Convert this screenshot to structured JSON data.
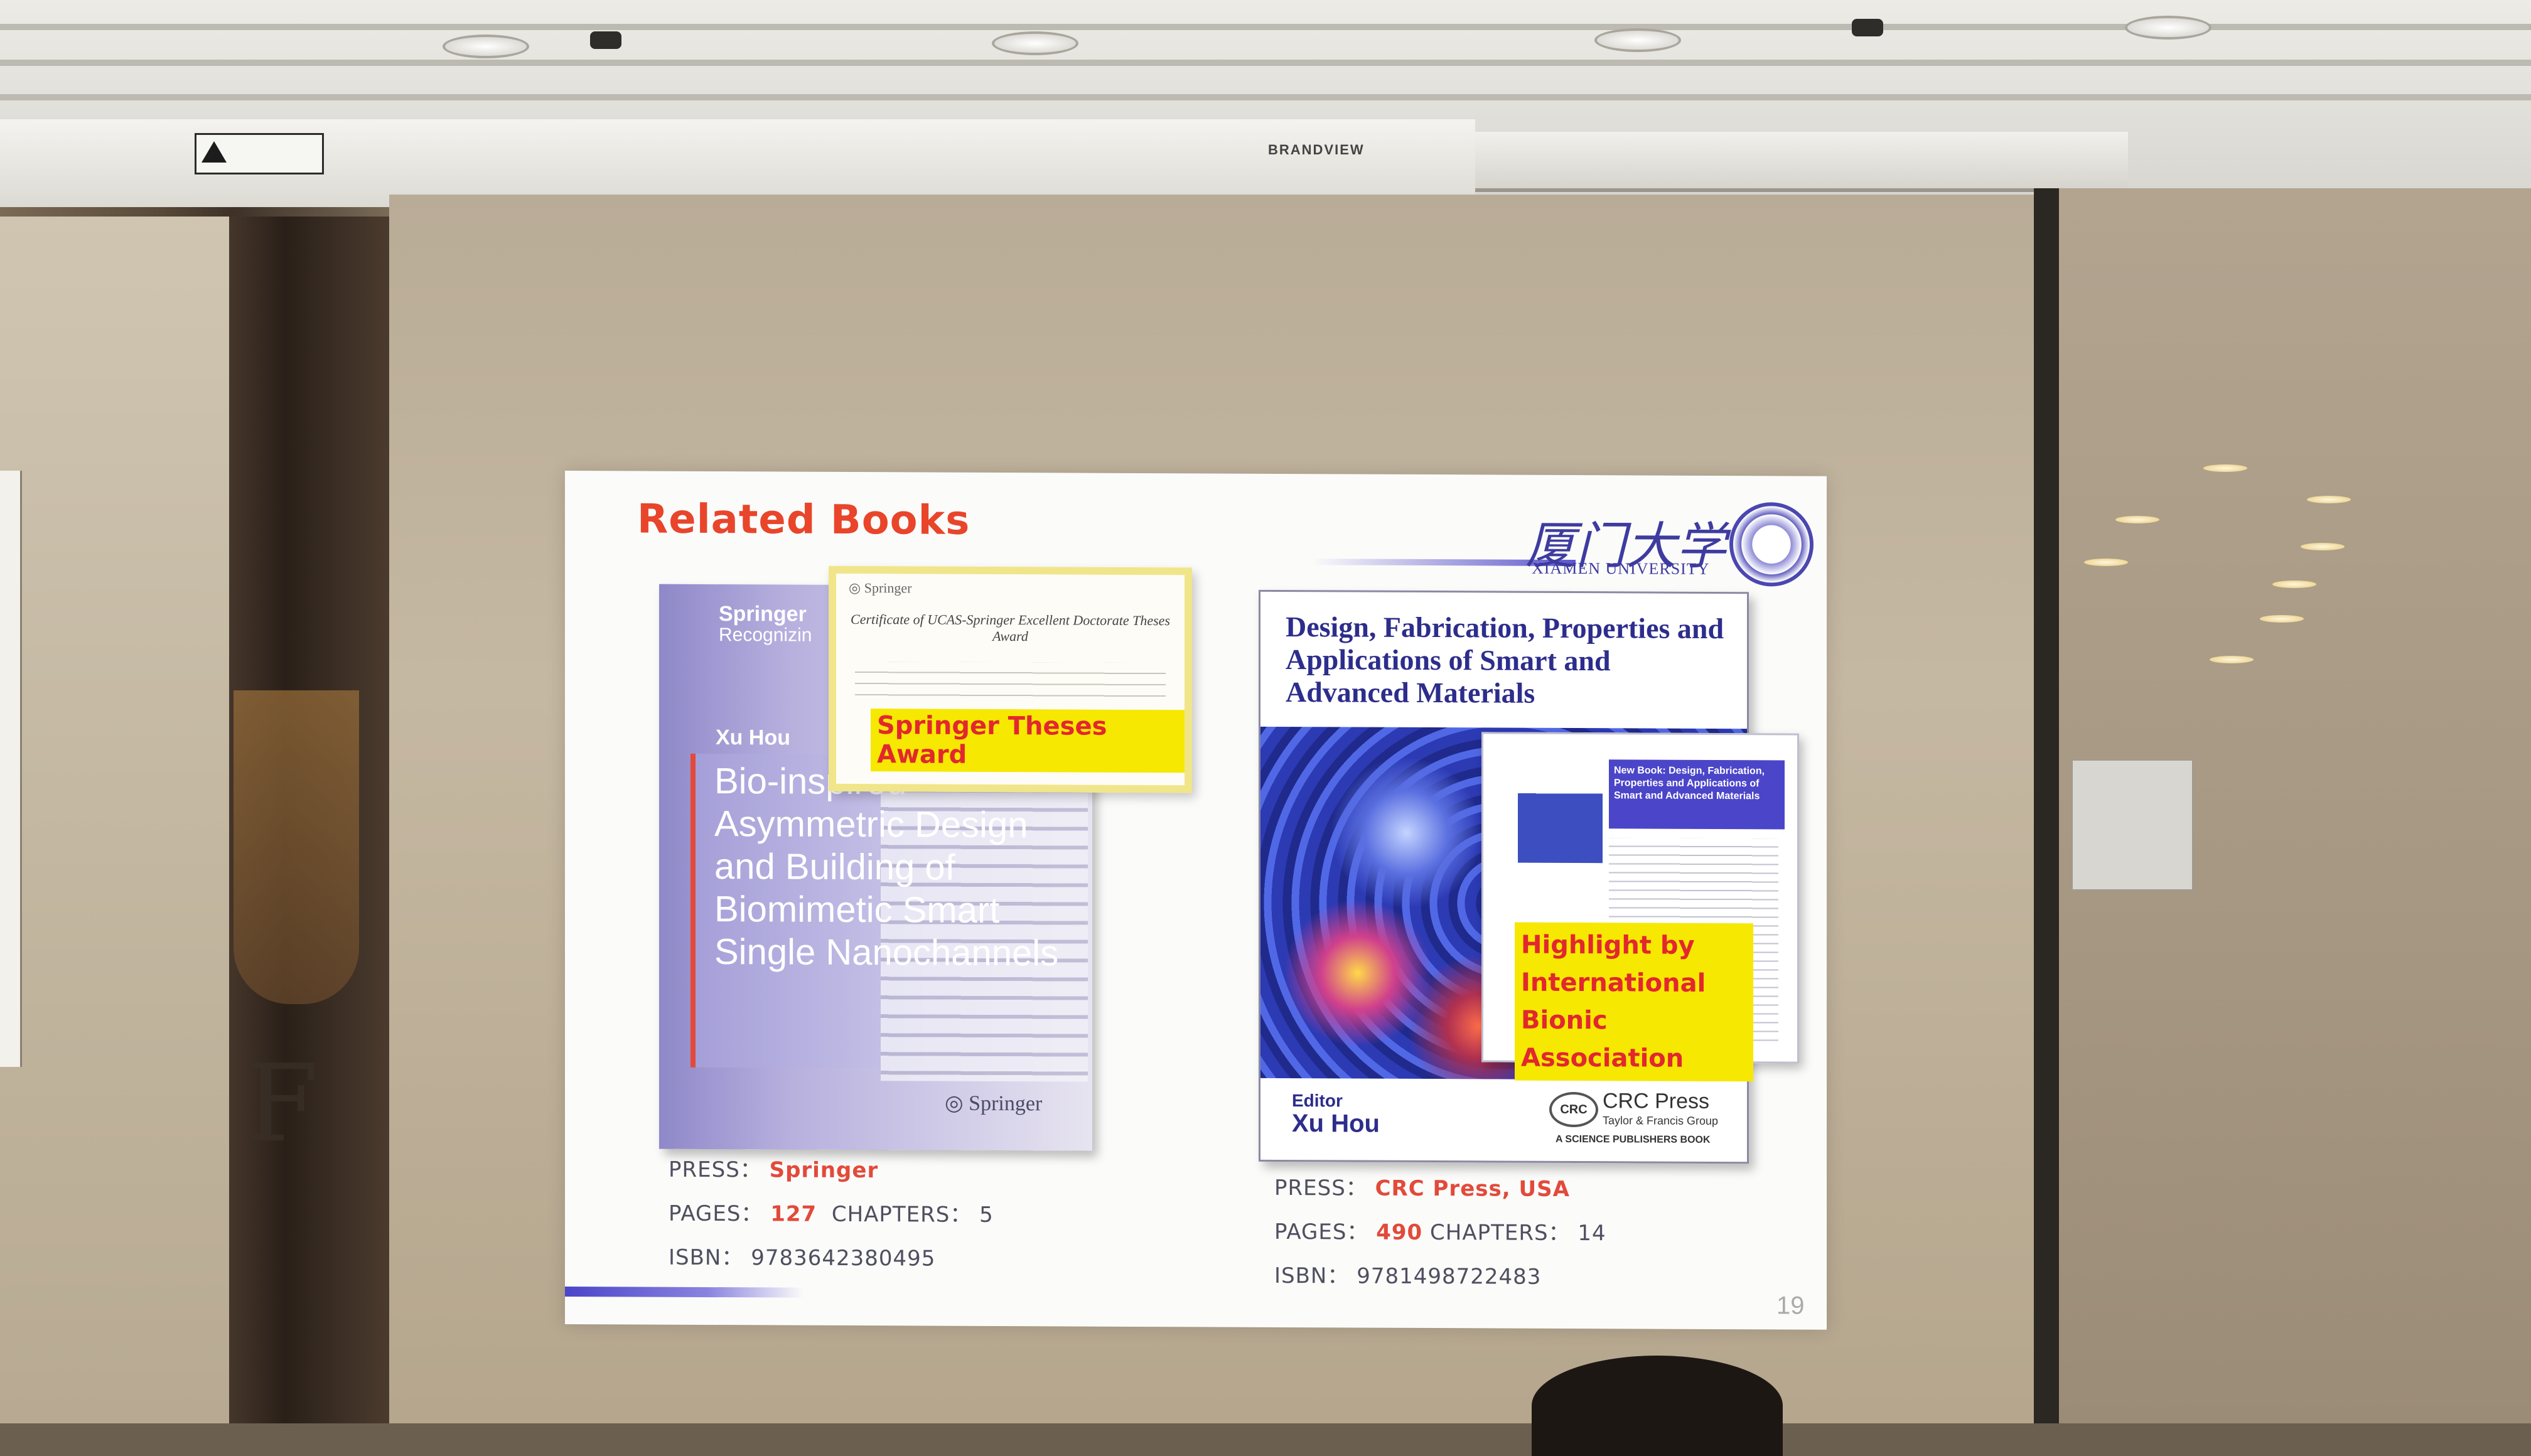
{
  "room": {
    "brand_label": "BRANDVIEW",
    "engraved_text": "F E"
  },
  "slide": {
    "title": "Related Books",
    "logo_cn": "厦门大学",
    "logo_en": "XIAMEN UNIVERSITY",
    "page_number": "19"
  },
  "book1": {
    "series": "Springer",
    "series_sub": "Recognizin",
    "author": "Xu Hou",
    "title": "Bio-inspired Asymmetric Design and Building of Biomimetic Smart Single Nanochannels",
    "publisher_mark": "Springer",
    "certificate": {
      "logo": "Springer",
      "title": "Certificate of UCAS-Springer Excellent Doctorate Theses Award",
      "award": "Springer Theses Award"
    },
    "press_label": "PRESS：",
    "press": "Springer",
    "pages_label": "PAGES：",
    "pages": "127",
    "chapters_label": "CHAPTERS：",
    "chapters": "5",
    "isbn_label": "ISBN：",
    "isbn": "9783642380495"
  },
  "book2": {
    "title": "Design, Fabrication, Properties and Applications of Smart and Advanced Materials",
    "editor_label": "Editor",
    "editor": "Xu Hou",
    "crc_logo": "CRC",
    "crc_press": "CRC Press",
    "crc_sub": "Taylor & Francis Group",
    "crc_sub2": "A SCIENCE PUBLISHERS BOOK",
    "flyer_head": "New Book: Design, Fabrication, Properties and Applications of Smart and Advanced Materials",
    "highlight": "Highlight by International Bionic Association",
    "press_label": "PRESS：",
    "press": "CRC Press, USA",
    "pages_label": "PAGES：",
    "pages": "490",
    "chapters_label": "CHAPTERS：",
    "chapters": "14",
    "isbn_label": "ISBN：",
    "isbn": "9781498722483"
  }
}
